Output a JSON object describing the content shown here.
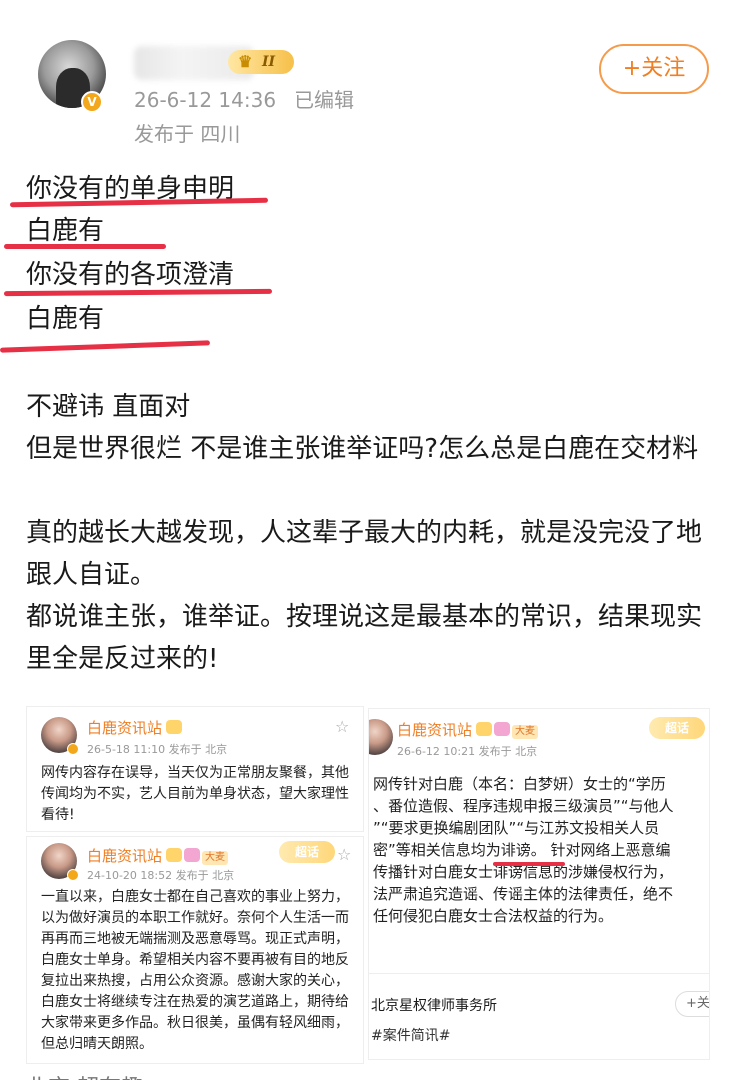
{
  "post": {
    "header": {
      "timestamp": "26-6-12 14:36",
      "edited": "已编辑",
      "location": "发布于 四川",
      "follow_label": "+关注",
      "badge_level": "II"
    },
    "highlighted_lines": [
      "你没有的单身申明",
      "白鹿有",
      "你没有的各项澄清",
      "白鹿有"
    ],
    "paragraphs": [
      "不避讳 直面对",
      "但是世界很烂 不是谁主张谁举证吗?怎么总是白鹿在交材料",
      "真的越长大越发现，人这辈子最大的内耗，就是没完没了地跟人自证。",
      "都说谁主张，谁举证。按理说这是最基本的常识，结果现实里全是反过来的!"
    ],
    "bottom_cut_text": "北京 超有趣"
  },
  "embedded": {
    "left_top": {
      "name": "白鹿资讯站",
      "meta": "26-5-18 11:10  发布于 北京",
      "text": "网传内容存在误导，当天仅为正常朋友聚餐，其他传闻均为不实，艺人目前为单身状态，望大家理性看待!"
    },
    "left_bottom": {
      "name": "白鹿资讯站",
      "big_tag": "大麦",
      "flair": "超话",
      "meta": "24-10-20 18:52  发布于 北京",
      "text": "一直以来，白鹿女士都在自己喜欢的事业上努力，以为做好演员的本职工作就好。奈何个人生活一而再再而三地被无端揣测及恶意辱骂。现正式声明，白鹿女士单身。希望相关内容不要再被有目的地反复拉出来热搜，占用公众资源。感谢大家的关心，白鹿女士将继续专注在热爱的演艺道路上，期待给大家带来更多作品。秋日很美，虽偶有轻风细雨，但总归晴天朗照。"
    },
    "right": {
      "name": "白鹿资讯站",
      "big_tag": "大麦",
      "flair": "超话",
      "meta": "26-6-12 10:21  发布于 北京",
      "lines": [
        "网传针对白鹿（本名：白梦妍）女士的“学历",
        "、番位造假、程序违规申报三级演员”“与他人",
        "”“要求更换编剧团队”“与江苏文投相关人员",
        "密”等相关信息均为诽谤。 针对网络上恶意编",
        "传播针对白鹿女士诽谤信息的涉嫌侵权行为，",
        "法严肃追究造谣、传谣主体的法律责任，绝不",
        "任何侵犯白鹿女士合法权益的行为。"
      ],
      "firm": "北京星权律师事务所",
      "follow": "+关",
      "hashtag": "#案件简讯#"
    }
  },
  "colors": {
    "accent_orange": "#f07e22",
    "highlight_red": "#e63045",
    "meta_gray": "#999999"
  }
}
